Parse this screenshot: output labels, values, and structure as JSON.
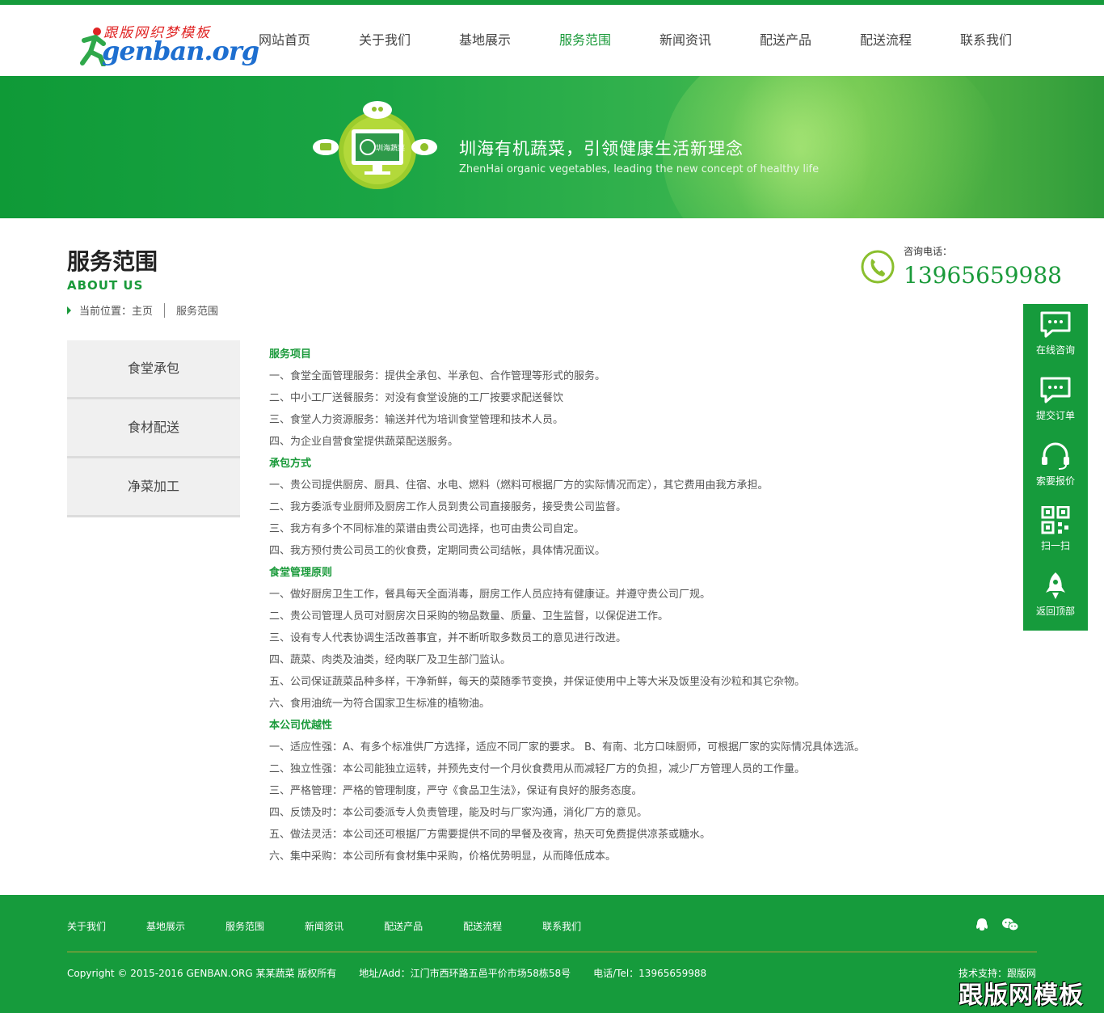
{
  "logo": {
    "tagline": "跟版网织梦模板",
    "wordmark": "genban.org"
  },
  "nav": {
    "items": [
      {
        "label": "网站首页"
      },
      {
        "label": "关于我们"
      },
      {
        "label": "基地展示"
      },
      {
        "label": "服务范围",
        "active": true
      },
      {
        "label": "新闻资讯"
      },
      {
        "label": "配送产品"
      },
      {
        "label": "配送流程"
      },
      {
        "label": "联系我们"
      }
    ]
  },
  "banner": {
    "badge_text": "圳海蔬菜",
    "title": "圳海有机蔬菜，引领健康生活新理念",
    "subtitle": "ZhenHai organic vegetables, leading the new concept of healthy life"
  },
  "page": {
    "title": "服务范围",
    "subtitle": "ABOUT US",
    "breadcrumb_prefix": "当前位置：主页",
    "breadcrumb_current": "服务范围"
  },
  "phone": {
    "label": "咨询电话：",
    "number": "13965659988"
  },
  "side_menu": {
    "items": [
      {
        "label": "食堂承包"
      },
      {
        "label": "食材配送"
      },
      {
        "label": "净菜加工"
      }
    ]
  },
  "content": {
    "sections": [
      {
        "heading": "服务项目",
        "lines": [
          "一、食堂全面管理服务：提供全承包、半承包、合作管理等形式的服务。",
          "二、中小工厂送餐服务：对没有食堂设施的工厂按要求配送餐饮",
          "三、食堂人力资源服务：输送并代为培训食堂管理和技术人员。",
          "四、为企业自营食堂提供蔬菜配送服务。"
        ]
      },
      {
        "heading": "承包方式",
        "lines": [
          "一、贵公司提供厨房、厨具、住宿、水电、燃料（燃料可根据厂方的实际情况而定），其它费用由我方承担。",
          "二、我方委派专业厨师及厨房工作人员到贵公司直接服务，接受贵公司监督。",
          "三、我方有多个不同标准的菜谱由贵公司选择，也可由贵公司自定。",
          "四、我方预付贵公司员工的伙食费，定期同贵公司结帐，具体情况面议。"
        ]
      },
      {
        "heading": "食堂管理原则",
        "lines": [
          "一、做好厨房卫生工作，餐具每天全面消毒，厨房工作人员应持有健康证。并遵守贵公司厂规。",
          "二、贵公司管理人员可对厨房次日采购的物品数量、质量、卫生监督，以保促进工作。",
          "三、设有专人代表协调生活改善事宜，并不断听取多数员工的意见进行改进。",
          "四、蔬菜、肉类及油类，经肉联厂及卫生部门监认。",
          "五、公司保证蔬菜品种多样，干净新鲜，每天的菜随季节变换，并保证使用中上等大米及饭里没有沙粒和其它杂物。",
          "六、食用油统一为符合国家卫生标准的植物油。"
        ]
      },
      {
        "heading": "本公司优越性",
        "lines": [
          "一、适应性强：A、有多个标准供厂方选择，适应不同厂家的要求。 B、有南、北方口味厨师，可根据厂家的实际情况具体选派。",
          "二、独立性强：本公司能独立运转，并预先支付一个月伙食费用从而减轻厂方的负担，减少厂方管理人员的工作量。",
          "三、严格管理：严格的管理制度，严守《食品卫生法》，保证有良好的服务态度。",
          "四、反馈及时：本公司委派专人负责管理，能及时与厂家沟通，消化厂方的意见。",
          "五、做法灵活：本公司还可根据厂方需要提供不同的早餐及夜宵，热天可免费提供凉茶或糖水。",
          "六、集中采购：本公司所有食材集中采购，价格优势明显，从而降低成本。"
        ]
      }
    ]
  },
  "float_bar": {
    "items": [
      {
        "label": "在线咨询",
        "icon": "chat-icon"
      },
      {
        "label": "提交订单",
        "icon": "chat-icon"
      },
      {
        "label": "索要报价",
        "icon": "headset-icon"
      },
      {
        "label": "扫一扫",
        "icon": "qrcode-icon"
      },
      {
        "label": "返回顶部",
        "icon": "rocket-icon"
      }
    ]
  },
  "footer": {
    "nav": [
      {
        "label": "关于我们"
      },
      {
        "label": "基地展示"
      },
      {
        "label": "服务范围"
      },
      {
        "label": "新闻资讯"
      },
      {
        "label": "配送产品"
      },
      {
        "label": "配送流程"
      },
      {
        "label": "联系我们"
      }
    ],
    "copyright": "Copyright © 2015-2016 GENBAN.ORG 某某蔬菜 版权所有",
    "address": "地址/Add：江门市西环路五邑平价市场58栋58号",
    "tel": "电话/Tel：13965659988",
    "tech": "技术支持：跟版网"
  },
  "watermark": "跟版网模板",
  "colors": {
    "brand_green": "#169b3c",
    "accent_green": "#1a9a3a"
  }
}
